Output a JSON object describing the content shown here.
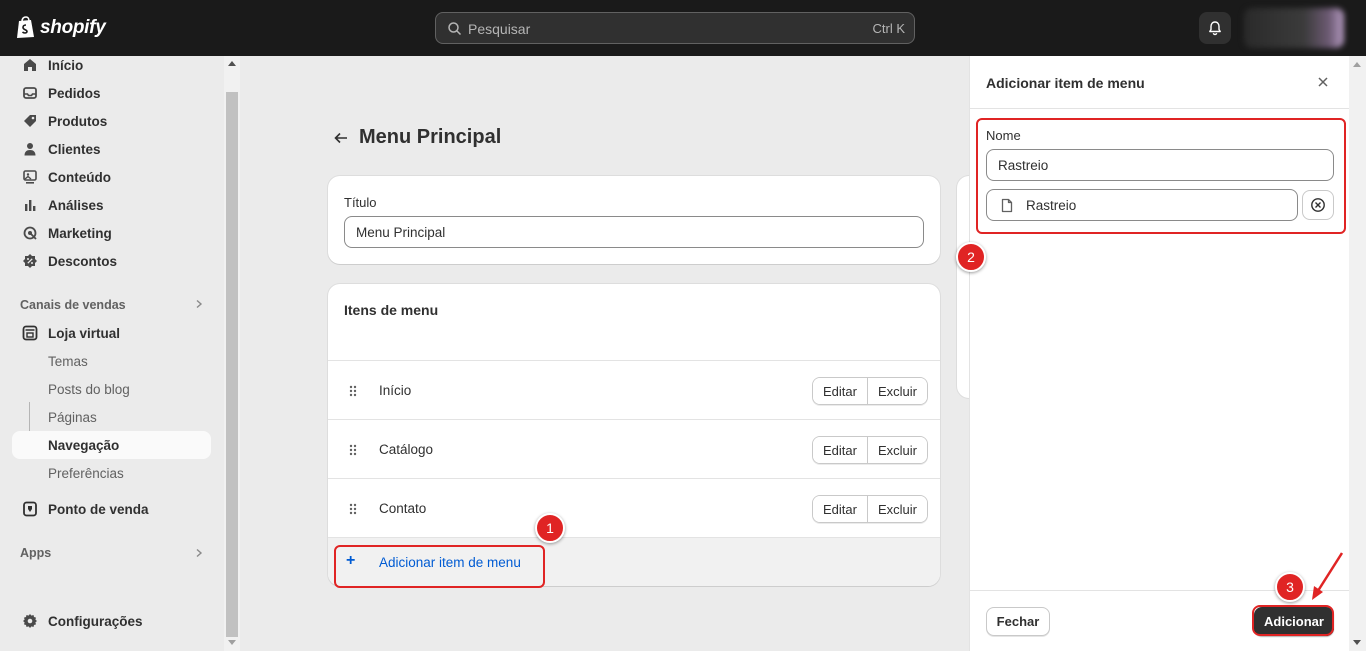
{
  "topbar": {
    "brand": "shopify",
    "search_placeholder": "Pesquisar",
    "search_shortcut": "Ctrl K"
  },
  "sidebar": {
    "items": [
      {
        "label": "Início",
        "icon": "home-icon"
      },
      {
        "label": "Pedidos",
        "icon": "inbox-icon"
      },
      {
        "label": "Produtos",
        "icon": "tag-icon"
      },
      {
        "label": "Clientes",
        "icon": "person-icon"
      },
      {
        "label": "Conteúdo",
        "icon": "content-icon"
      },
      {
        "label": "Análises",
        "icon": "bar-chart-icon"
      },
      {
        "label": "Marketing",
        "icon": "target-icon"
      },
      {
        "label": "Descontos",
        "icon": "discount-icon"
      }
    ],
    "sales_channels_header": "Canais de vendas",
    "online_store": "Loja virtual",
    "sub_items": [
      "Temas",
      "Posts do blog",
      "Páginas",
      "Navegação",
      "Preferências"
    ],
    "active_sub_item": "Navegação",
    "pos": "Ponto de venda",
    "apps_header": "Apps",
    "settings": "Configurações"
  },
  "main": {
    "page_title": "Menu Principal",
    "title_label": "Título",
    "title_value": "Menu Principal",
    "menu_items_header": "Itens de menu",
    "menu_items": [
      {
        "label": "Início",
        "edit": "Editar",
        "delete": "Excluir"
      },
      {
        "label": "Catálogo",
        "edit": "Editar",
        "delete": "Excluir"
      },
      {
        "label": "Contato",
        "edit": "Editar",
        "delete": "Excluir"
      }
    ],
    "add_item_label": "Adicionar item de menu"
  },
  "panel": {
    "title": "Adicionar item de menu",
    "name_label": "Nome",
    "name_value": "Rastreio",
    "link_value": "Rastreio",
    "close_button": "Fechar",
    "add_button": "Adicionar"
  },
  "annotations": [
    "1",
    "2",
    "3"
  ],
  "colors": {
    "topbar": "#1a1a1a",
    "link": "#005bd3",
    "primary_button": "#303030",
    "annotation": "#e02424"
  }
}
